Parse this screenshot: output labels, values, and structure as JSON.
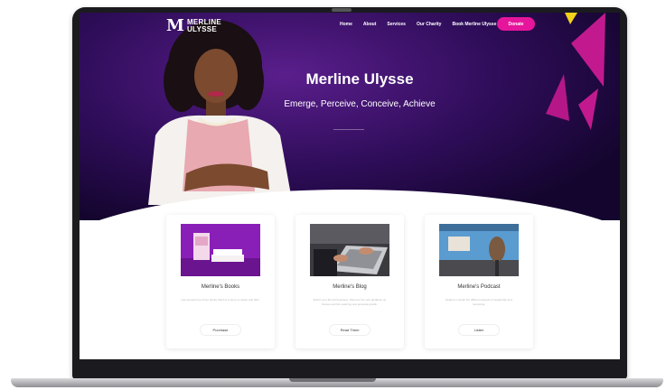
{
  "site": {
    "logo_mark": "M",
    "logo_line1": "MERLINE",
    "logo_line2": "ULYSSE"
  },
  "nav": {
    "items": [
      "Home",
      "About",
      "Services",
      "Our Charity",
      "Book Merline Ulysse"
    ],
    "donate_label": "Donate"
  },
  "hero": {
    "title": "Merline Ulysse",
    "tagline": "Emerge, Perceive, Conceive, Achieve"
  },
  "cards": [
    {
      "title": "Merline's Books",
      "text": "Get yourself one of her books. Each is a story to inspire and offer.",
      "button": "Purchase"
    },
    {
      "title": "Merline's Blog",
      "text": "Enrich your life and business. Discover her own guidance on finance and life coaching and personal growth.",
      "button": "Read Them"
    },
    {
      "title": "Merline's Podcast",
      "text": "Explore in depth the different aspects of leadership and mentoring.",
      "button": "Listen"
    }
  ],
  "colors": {
    "hero_dark": "#14052e",
    "hero_purple": "#5a1e8c",
    "accent_pink": "#e5169b",
    "accent_yellow": "#f2d21b"
  }
}
